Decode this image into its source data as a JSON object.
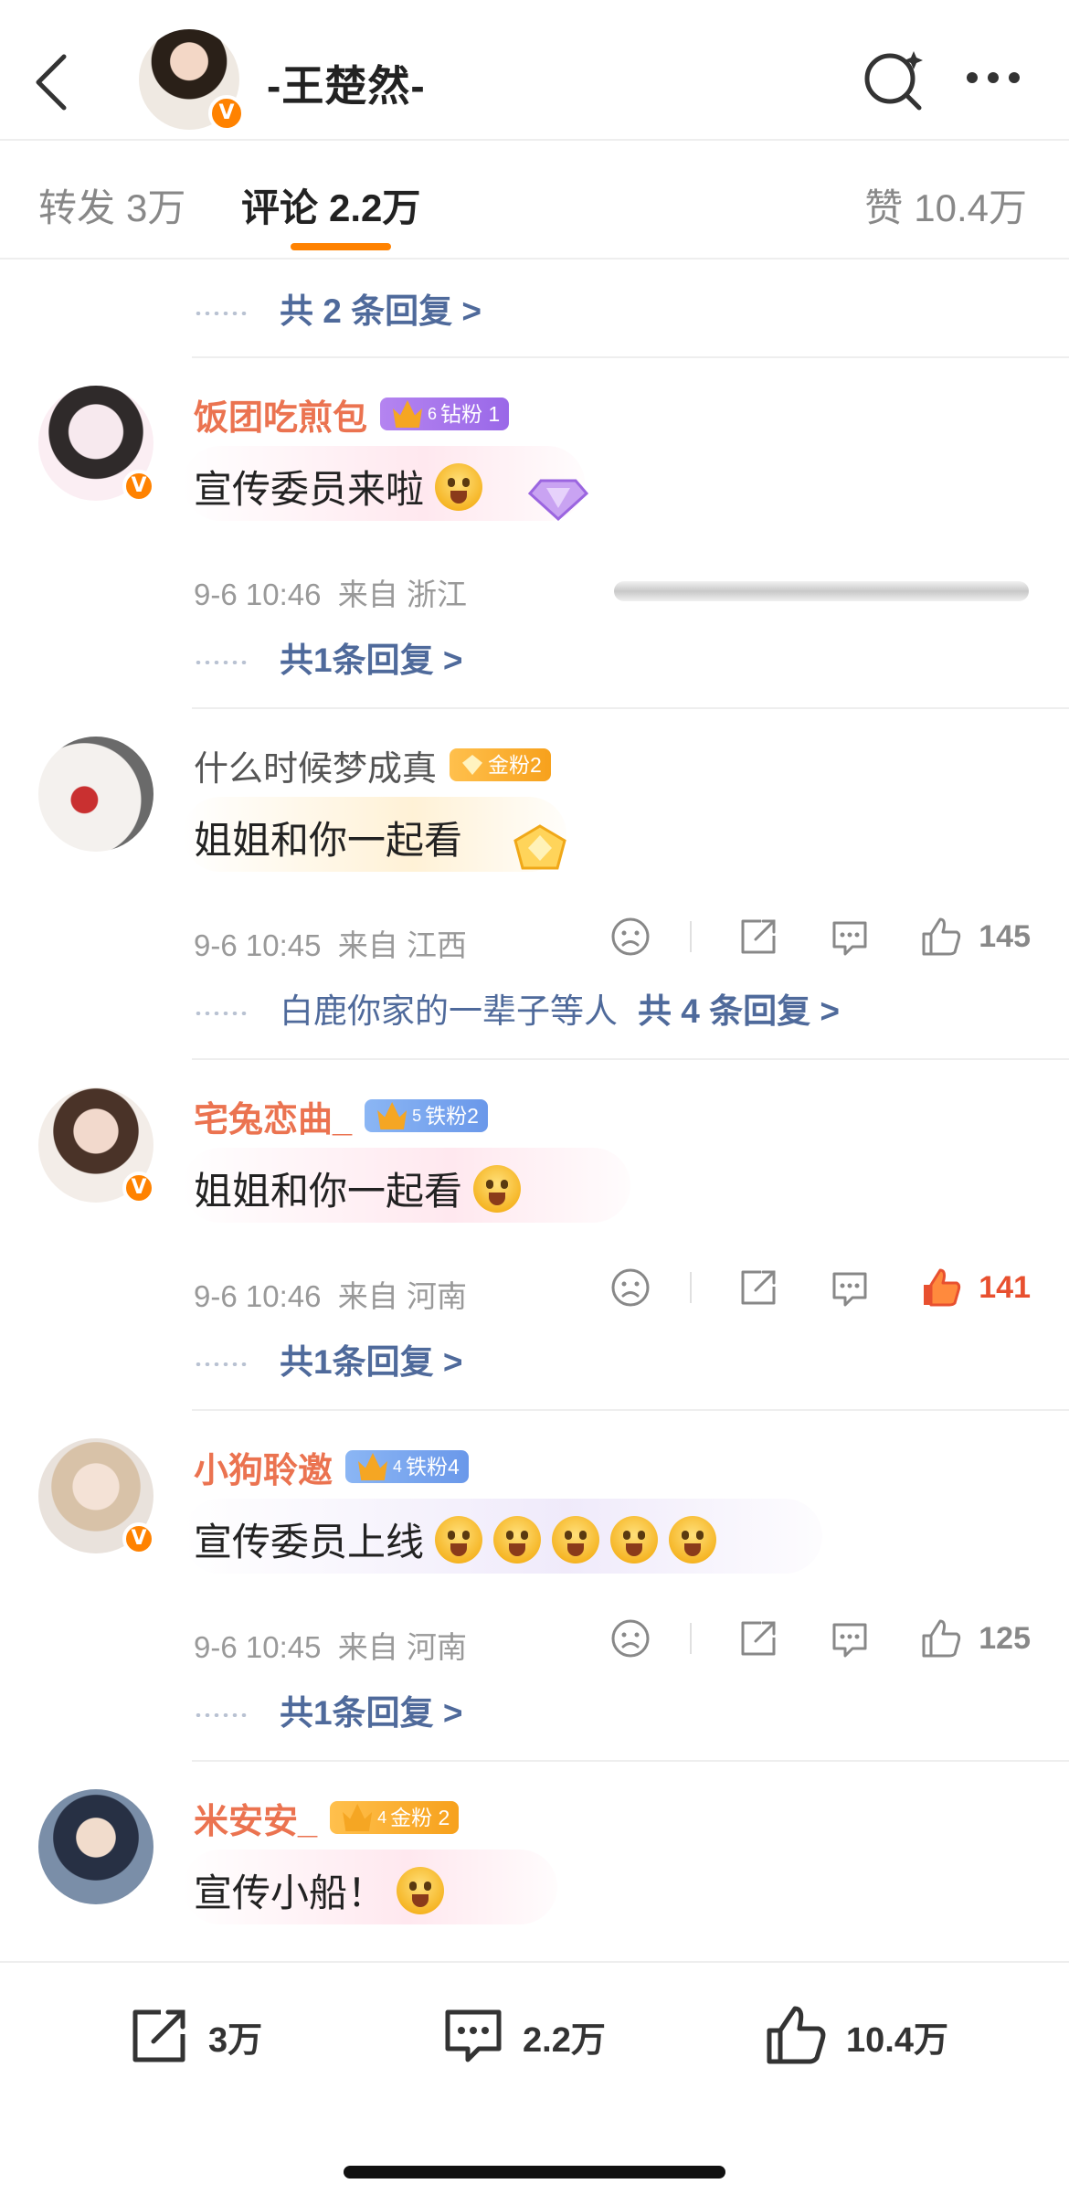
{
  "header": {
    "title": "-王楚然-",
    "verified_mark": "V",
    "icons": {
      "back": "chevron-left-icon",
      "search": "search-sparkle-icon",
      "more": "more-dots-icon"
    }
  },
  "tabs": {
    "repost": {
      "label": "转发",
      "count": "3万"
    },
    "comment": {
      "label": "评论",
      "count": "2.2万",
      "active": true
    },
    "like": {
      "label": "赞",
      "count": "10.4万"
    },
    "accent_color": "#ff8200"
  },
  "top_reply": {
    "label": "共 2 条回复 >"
  },
  "comments": [
    {
      "name": "饭团吃煎包",
      "fan_level": "6",
      "fan_badge": "钻粉 1",
      "verified": "V",
      "text": "宣传委员来啦",
      "time": "9-6 10:46",
      "location": "来自 浙江",
      "reply_label": "共1条回复 >"
    },
    {
      "name": "什么时候梦成真",
      "fan_badge": "金粉2",
      "text": "姐姐和你一起看",
      "time": "9-6 10:45",
      "location": "来自 江西",
      "likes": "145",
      "reply_preview": "白鹿你家的一辈子等人",
      "reply_label": "共 4 条回复 >"
    },
    {
      "name": "宅兔恋曲_",
      "fan_level": "5",
      "fan_badge": "铁粉2",
      "verified": "V",
      "text": "姐姐和你一起看",
      "time": "9-6 10:46",
      "location": "来自 河南",
      "likes": "141",
      "liked": true,
      "reply_label": "共1条回复 >"
    },
    {
      "name": "小狗聆邀",
      "fan_level": "4",
      "fan_badge": "铁粉4",
      "verified": "V",
      "text": "宣传委员上线",
      "time": "9-6 10:45",
      "location": "来自 河南",
      "likes": "125",
      "reply_label": "共1条回复 >"
    },
    {
      "name": "米安安_",
      "fan_level": "4",
      "fan_badge": "金粉 2",
      "text": "宣传小船！"
    }
  ],
  "bottom_bar": {
    "repost": "3万",
    "comment": "2.2万",
    "like": "10.4万"
  },
  "colors": {
    "name_orange": "#eb7350",
    "reply_blue": "#4f6a9b",
    "liked_red": "#e8502f"
  }
}
